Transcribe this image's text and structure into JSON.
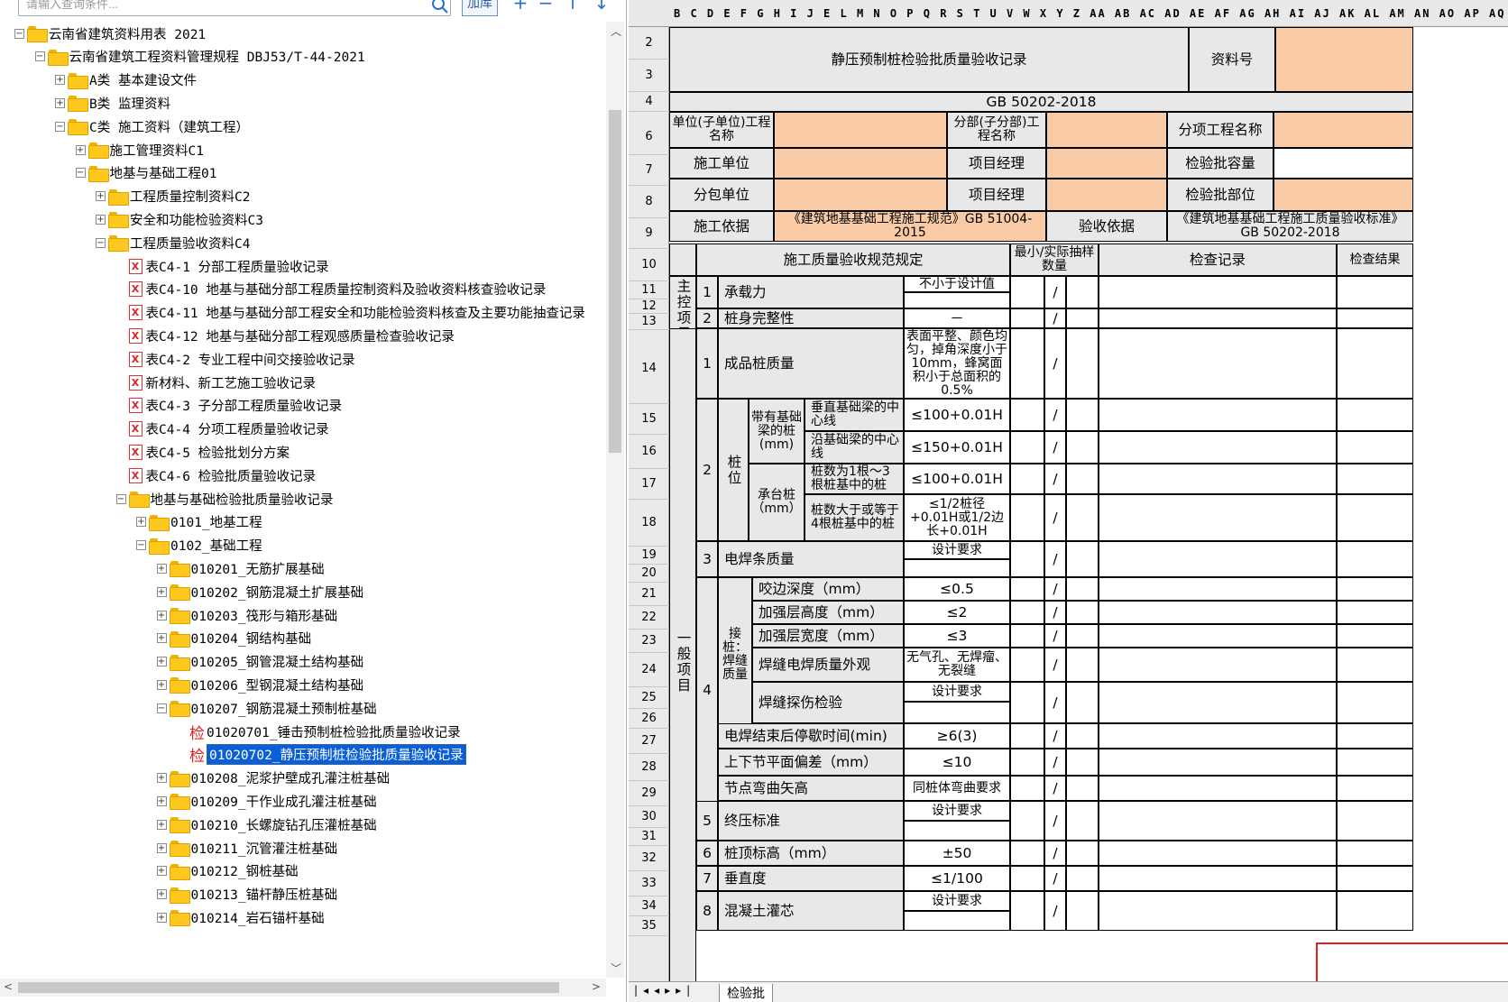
{
  "search": {
    "placeholder": "请输入查询条件...",
    "add_label": "加库"
  },
  "toolbar": {
    "add": "+",
    "remove": "−",
    "up": "↑",
    "down": "↓"
  },
  "tree": [
    {
      "label": "云南省建筑资料用表 2021",
      "type": "folder",
      "level": 0,
      "exp": "−"
    },
    {
      "label": "云南省建筑工程资料管理规程 DBJ53/T-44-2021",
      "type": "folder",
      "level": 1,
      "exp": "−"
    },
    {
      "label": "A类 基本建设文件",
      "type": "folder",
      "level": 2,
      "exp": "+"
    },
    {
      "label": "B类 监理资料",
      "type": "folder",
      "level": 2,
      "exp": "+"
    },
    {
      "label": "C类 施工资料（建筑工程）",
      "type": "folder",
      "level": 2,
      "exp": "−"
    },
    {
      "label": "施工管理资料C1",
      "type": "folder",
      "level": 3,
      "exp": "+"
    },
    {
      "label": "地基与基础工程01",
      "type": "folder",
      "level": 3,
      "exp": "−"
    },
    {
      "label": "工程质量控制资料C2",
      "type": "folder",
      "level": 4,
      "exp": "+"
    },
    {
      "label": "安全和功能检验资料C3",
      "type": "folder",
      "level": 4,
      "exp": "+"
    },
    {
      "label": "工程质量验收资料C4",
      "type": "folder",
      "level": 4,
      "exp": "−"
    },
    {
      "label": "表C4-1 分部工程质量验收记录",
      "type": "doc",
      "level": 5
    },
    {
      "label": "表C4-10 地基与基础分部工程质量控制资料及验收资料核查验收记录",
      "type": "doc",
      "level": 5
    },
    {
      "label": "表C4-11 地基与基础分部工程安全和功能检验资料核查及主要功能抽查记录",
      "type": "doc",
      "level": 5
    },
    {
      "label": "表C4-12 地基与基础分部工程观感质量检查验收记录",
      "type": "doc",
      "level": 5
    },
    {
      "label": "表C4-2 专业工程中间交接验收记录",
      "type": "doc",
      "level": 5
    },
    {
      "label": "新材料、新工艺施工验收记录",
      "type": "doc",
      "level": 5
    },
    {
      "label": "表C4-3 子分部工程质量验收记录",
      "type": "doc",
      "level": 5
    },
    {
      "label": "表C4-4 分项工程质量验收记录",
      "type": "doc",
      "level": 5
    },
    {
      "label": "表C4-5 检验批划分方案",
      "type": "doc",
      "level": 5
    },
    {
      "label": "表C4-6 检验批质量验收记录",
      "type": "doc",
      "level": 5
    },
    {
      "label": "地基与基础检验批质量验收记录",
      "type": "folder",
      "level": 5,
      "exp": "−"
    },
    {
      "label": "0101_地基工程",
      "type": "folder",
      "level": 6,
      "exp": "+"
    },
    {
      "label": "0102_基础工程",
      "type": "folder",
      "level": 6,
      "exp": "−"
    },
    {
      "label": "010201_无筋扩展基础",
      "type": "folder",
      "level": 7,
      "exp": "+"
    },
    {
      "label": "010202_钢筋混凝土扩展基础",
      "type": "folder",
      "level": 7,
      "exp": "+"
    },
    {
      "label": "010203_筏形与箱形基础",
      "type": "folder",
      "level": 7,
      "exp": "+"
    },
    {
      "label": "010204_钢结构基础",
      "type": "folder",
      "level": 7,
      "exp": "+"
    },
    {
      "label": "010205_钢管混凝土结构基础",
      "type": "folder",
      "level": 7,
      "exp": "+"
    },
    {
      "label": "010206_型钢混凝土结构基础",
      "type": "folder",
      "level": 7,
      "exp": "+"
    },
    {
      "label": "010207_钢筋混凝土预制桩基础",
      "type": "folder",
      "level": 7,
      "exp": "−"
    },
    {
      "label": "01020701_锤击预制桩检验批质量验收记录",
      "type": "check",
      "level": 8
    },
    {
      "label": "01020702_静压预制桩检验批质量验收记录",
      "type": "check",
      "level": 8,
      "selected": true
    },
    {
      "label": "010208_泥浆护壁成孔灌注桩基础",
      "type": "folder",
      "level": 7,
      "exp": "+"
    },
    {
      "label": "010209_干作业成孔灌注桩基础",
      "type": "folder",
      "level": 7,
      "exp": "+"
    },
    {
      "label": "010210_长螺旋钻孔压灌桩基础",
      "type": "folder",
      "level": 7,
      "exp": "+"
    },
    {
      "label": "010211_沉管灌注桩基础",
      "type": "folder",
      "level": 7,
      "exp": "+"
    },
    {
      "label": "010212_钢桩基础",
      "type": "folder",
      "level": 7,
      "exp": "+"
    },
    {
      "label": "010213_锚杆静压桩基础",
      "type": "folder",
      "level": 7,
      "exp": "+"
    },
    {
      "label": "010214_岩石锚杆基础",
      "type": "folder",
      "level": 7,
      "exp": "+"
    }
  ],
  "icons": {
    "doc": "X",
    "check": "检"
  },
  "columns": "B C D E F G H I J E L M N O P Q R S T U V W X Y Z AA AB AC AD AE AF AG AH AI AJ AK AL AM AN AO AP AQ AR AS AT AU AV AW AX AY AZ BA BB BC BD BE BF BG",
  "rows": [
    "2",
    "3",
    "4",
    "6",
    "7",
    "8",
    "9",
    "10",
    "11",
    "12",
    "13",
    "14",
    "15",
    "16",
    "17",
    "18",
    "19",
    "20",
    "21",
    "22",
    "23",
    "24",
    "25",
    "26",
    "27",
    "28",
    "29",
    "30",
    "31",
    "32",
    "33",
    "34",
    "35"
  ],
  "form": {
    "title": "静压预制桩检验批质量验收记录",
    "docno_label": "资料号",
    "standard": "GB 50202-2018",
    "unit_name": "单位(子单位)工程名称",
    "sub_name": "分部(子分部)工程名称",
    "item_name": "分项工程名称",
    "contractor": "施工单位",
    "pm": "项目经理",
    "capacity": "检验批容量",
    "subcontractor": "分包单位",
    "pm2": "项目经理",
    "location": "检验批部位",
    "basis": "施工依据",
    "basis_val": "《建筑地基基础工程施工规范》GB 51004-2015",
    "accept": "验收依据",
    "accept_val": "《建筑地基基础工程施工质量验收标准》GB 50202-2018",
    "h_spec": "施工质量验收规范规定",
    "h_count": "最小/实际抽样数量",
    "h_record": "检查记录",
    "h_result": "检查结果",
    "main": "主控项目",
    "general": "一般项目",
    "m1": "承载力",
    "m1v": "不小于设计值",
    "m2": "桩身完整性",
    "m2v": "－",
    "g1": "成品桩质量",
    "g1v": "表面平整、颜色均匀，掉角深度小于10mm，蜂窝面积小于总面积的0.5%",
    "pos": "桩位",
    "base": "带有基础梁的桩(mm)",
    "b1": "垂直基础梁的中心线",
    "b1v": "≤100+0.01H",
    "b2": "沿基础梁的中心线",
    "b2v": "≤150+0.01H",
    "cap": "承台桩（mm）",
    "c1": "桩数为1根～3根桩基中的桩",
    "c1v": "≤100+0.01H",
    "c2": "桩数大于或等于4根桩基中的桩",
    "c2v": "≤1/2桩径+0.01H或1/2边长+0.01H",
    "g3": "电焊条质量",
    "design": "设计要求",
    "weld": "接桩：焊缝质量",
    "w1": "咬边深度（mm）",
    "w1v": "≤0.5",
    "w2": "加强层高度（mm）",
    "w2v": "≤2",
    "w3": "加强层宽度（mm）",
    "w3v": "≤3",
    "w4": "焊缝电焊质量外观",
    "w4v": "无气孔、无焊瘤、无裂缝",
    "w5": "焊缝探伤检验",
    "w6": "电焊结束后停歇时间(min)",
    "w6v": "≥6(3)",
    "w7": "上下节平面偏差（mm）",
    "w7v": "≤10",
    "w8": "节点弯曲矢高",
    "w8v": "同桩体弯曲要求",
    "g5": "终压标准",
    "g6": "桩顶标高（mm）",
    "g6v": "±50",
    "g7": "垂直度",
    "g7v": "≤1/100",
    "g8": "混凝土灌芯",
    "slash": "/",
    "n1": "1",
    "n2": "2",
    "n3": "3",
    "n4": "4",
    "n5": "5",
    "n6": "6",
    "n7": "7",
    "n8": "8"
  },
  "sheet_tab": "检验批"
}
